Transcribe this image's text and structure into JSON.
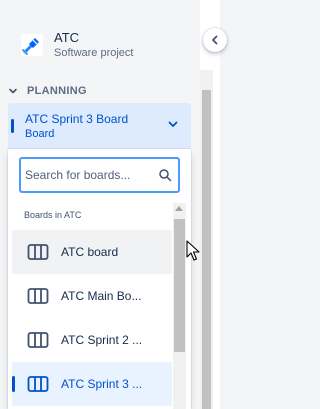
{
  "project": {
    "name": "ATC",
    "type": "Software project"
  },
  "planning": {
    "label": "PLANNING"
  },
  "board_selector": {
    "title": "ATC Sprint 3 Board",
    "subtitle": "Board"
  },
  "dropdown": {
    "search_placeholder": "Search for boards...",
    "search_value": "",
    "section_label": "Boards in ATC",
    "items": [
      {
        "label": "ATC board",
        "state": "hovered"
      },
      {
        "label": "ATC Main Bo...",
        "state": "normal"
      },
      {
        "label": "ATC Sprint 2 ...",
        "state": "normal"
      },
      {
        "label": "ATC Sprint 3 ...",
        "state": "selected"
      }
    ]
  },
  "colors": {
    "accent": "#0052cc",
    "selected_bg": "#deebff",
    "focus_border": "#4c9aff",
    "sidebar_bg": "#f4f5f7"
  },
  "icons": {
    "project_logo": "project-logo-icon",
    "planning_toggle": "chevron-down-icon",
    "selector_toggle": "chevron-down-icon",
    "search": "search-icon",
    "board": "board-columns-icon",
    "collapse": "chevron-left-icon"
  }
}
